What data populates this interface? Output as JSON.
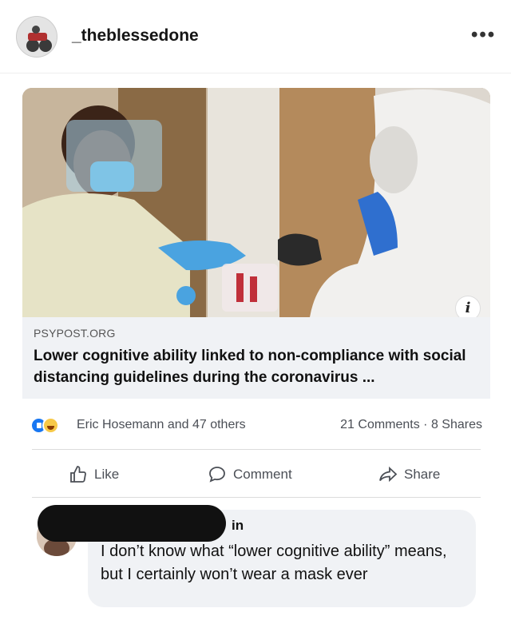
{
  "instagram": {
    "username": "_theblessedone",
    "more_icon": "more-horizontal-icon"
  },
  "post": {
    "link": {
      "domain": "PSYPOST.ORG",
      "title": "Lower cognitive ability linked to non-compliance with social distancing guidelines during the coronavirus ...",
      "info_icon_glyph": "i"
    },
    "reactions": {
      "reactors_text": "Eric Hosemann and 47 others",
      "counts_text": "21 Comments · 8 Shares",
      "colors": {
        "like": "#1877f2",
        "haha": "#f7c948"
      }
    },
    "actions": {
      "like": "Like",
      "comment": "Comment",
      "share": "Share"
    }
  },
  "comment": {
    "name_fragment": "in",
    "text": "I don’t know what “lower cognitive ability” means, but I certainly won’t wear a mask ever"
  },
  "colors": {
    "link_meta_bg": "#f0f2f5",
    "comment_bg": "#f0f2f5",
    "redaction": "#111111"
  }
}
